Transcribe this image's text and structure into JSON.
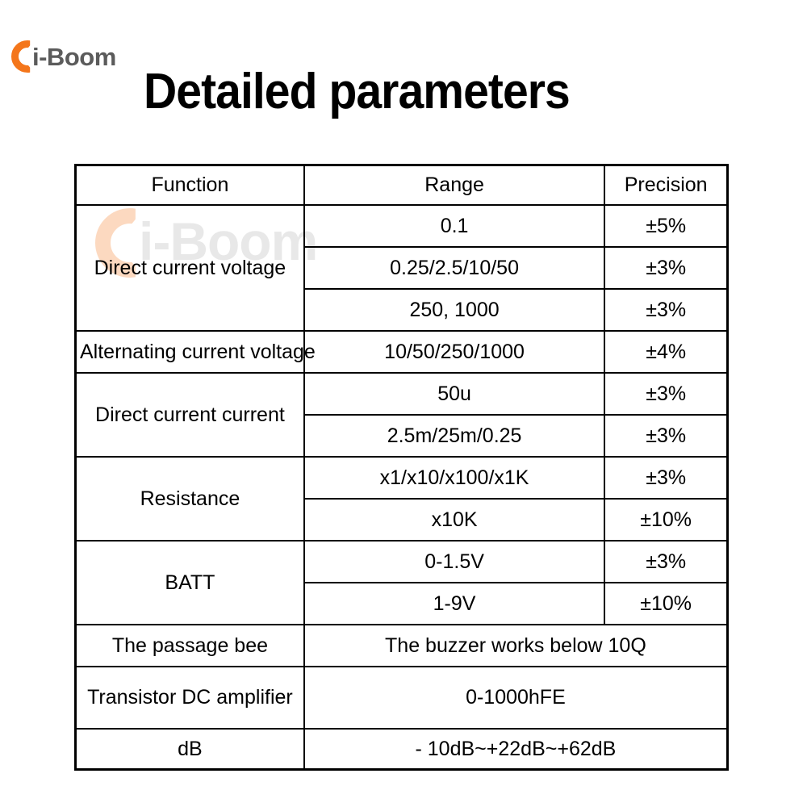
{
  "brand": {
    "name": "i-Boom",
    "crescent_color": "#F4761B",
    "text_color": "#5B5B5B"
  },
  "watermark": {
    "name": "i-Boom"
  },
  "title": "Detailed parameters",
  "table": {
    "headers": {
      "function": "Function",
      "range": "Range",
      "precision": "Precision"
    },
    "rows": [
      {
        "function": "Direct current voltage",
        "entries": [
          {
            "range": "0.1",
            "precision": "±5%"
          },
          {
            "range": "0.25/2.5/10/50",
            "precision": "±3%"
          },
          {
            "range": "250, 1000",
            "precision": "±3%"
          }
        ]
      },
      {
        "function": "Alternating current voltage",
        "entries": [
          {
            "range": "10/50/250/1000",
            "precision": "±4%"
          }
        ]
      },
      {
        "function": "Direct current current",
        "entries": [
          {
            "range": "50u",
            "precision": "±3%"
          },
          {
            "range": "2.5m/25m/0.25",
            "precision": "±3%"
          }
        ]
      },
      {
        "function": "Resistance",
        "entries": [
          {
            "range": "x1/x10/x100/x1K",
            "precision": "±3%"
          },
          {
            "range": "x10K",
            "precision": "±10%"
          }
        ]
      },
      {
        "function": "BATT",
        "entries": [
          {
            "range": "0-1.5V",
            "precision": "±3%"
          },
          {
            "range": "1-9V",
            "precision": "±10%"
          }
        ]
      },
      {
        "function": "The passage bee",
        "entries": [
          {
            "range": "The buzzer works below 10Q",
            "precision": null
          }
        ]
      },
      {
        "function": "Transistor DC amplifier",
        "entries": [
          {
            "range": "0-1000hFE",
            "precision": null
          }
        ]
      },
      {
        "function": "dB",
        "entries": [
          {
            "range": "- 10dB~+22dB~+62dB",
            "precision": null
          }
        ]
      }
    ]
  }
}
